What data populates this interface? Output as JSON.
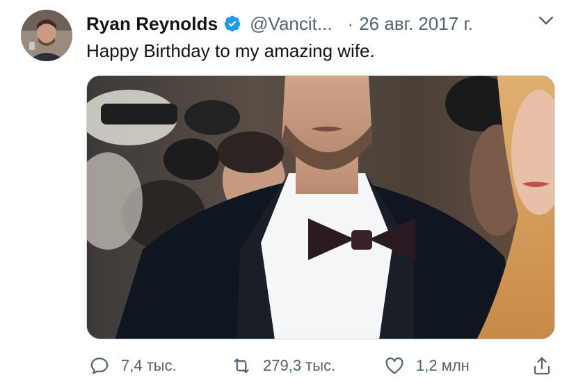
{
  "author": {
    "name": "Ryan Reynolds",
    "handle": "@Vancit...",
    "separator": "·",
    "date": "26 авг. 2017 г.",
    "verified_color": "#1d9bf0"
  },
  "tweet": {
    "text": "Happy Birthday to my amazing wife."
  },
  "media": {
    "kind": "photo",
    "description_icon": "photo"
  },
  "actions": {
    "reply_count": "7,4 тыс.",
    "retweet_count": "279,3 тыс.",
    "like_count": "1,2 млн",
    "reply_icon": "reply-icon",
    "retweet_icon": "retweet-icon",
    "like_icon": "heart-icon",
    "share_icon": "share-icon"
  },
  "colors": {
    "text_primary": "#0f1419",
    "text_secondary": "#536471",
    "accent": "#1d9bf0"
  }
}
